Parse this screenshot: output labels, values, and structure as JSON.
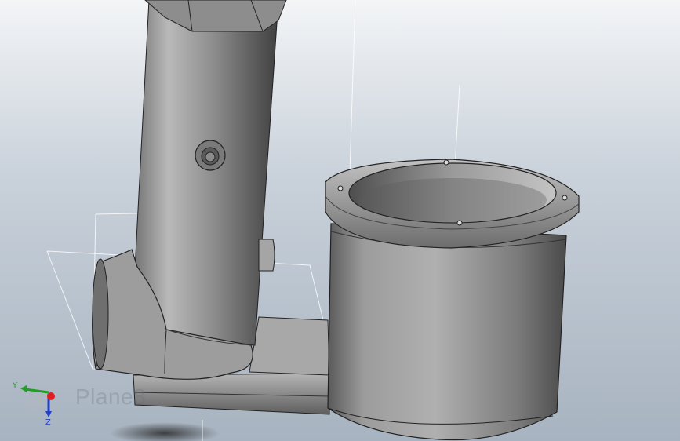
{
  "viewport": {
    "plane_label": "Plane8",
    "triad": {
      "x_label": "",
      "y_label": "Y",
      "z_label": "Z",
      "colors": {
        "x": "#e02020",
        "y": "#20a020",
        "z": "#2040d0"
      }
    },
    "background": {
      "top": "#f3f5f7",
      "bottom": "#a7b3c0"
    },
    "part_color": "#9a9a9a"
  }
}
